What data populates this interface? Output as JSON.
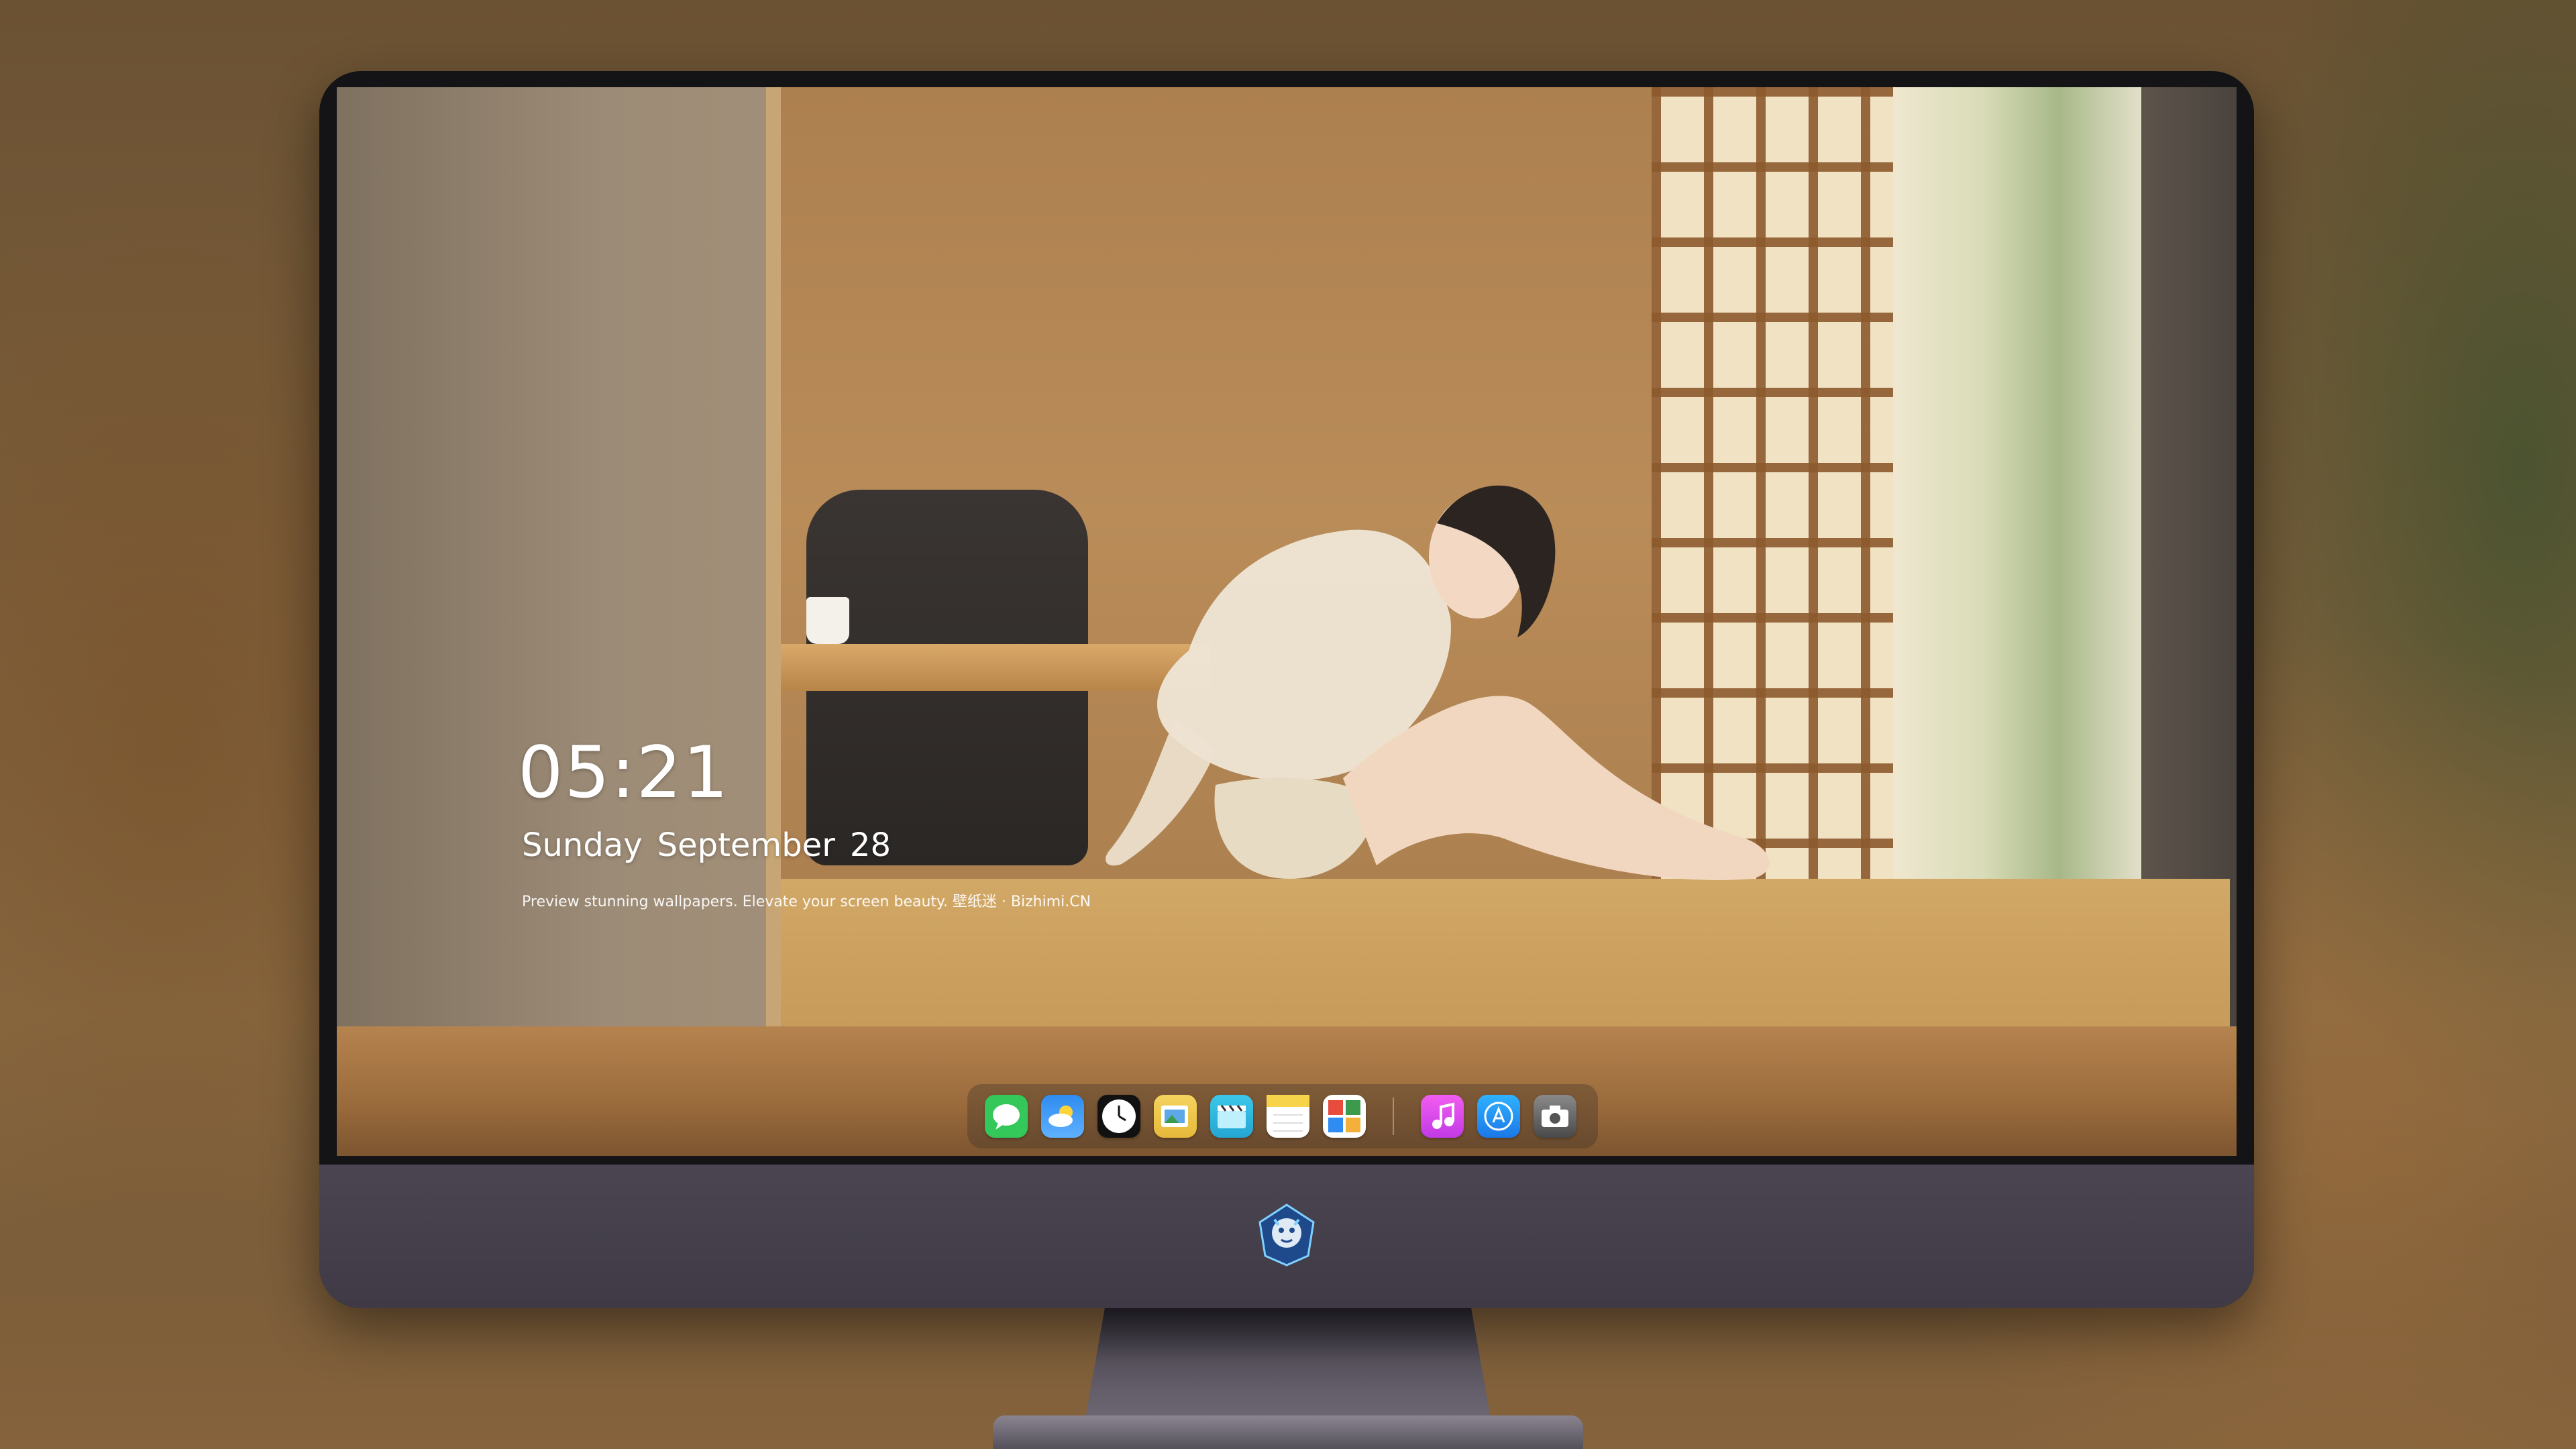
{
  "lock_screen": {
    "time": "05:21",
    "weekday": "Sunday",
    "month": "September",
    "day": "28",
    "tagline": "Preview stunning wallpapers. Elevate your screen beauty. 壁纸迷 · Bizhimi.CN"
  },
  "dock": {
    "apps": [
      {
        "name": "messages-icon",
        "color": "#34c759"
      },
      {
        "name": "weather-icon",
        "color": "#2f8cf0"
      },
      {
        "name": "clock-icon",
        "color": "#111111"
      },
      {
        "name": "preview-icon",
        "color": "#f4d35e"
      },
      {
        "name": "clips-icon",
        "color": "#3cc7e8"
      },
      {
        "name": "notes-icon",
        "color": "#f7d34b"
      },
      {
        "name": "photo-booth-icon",
        "color": "#e84c3d"
      },
      {
        "name": "music-icon",
        "color": "#d84cf0"
      },
      {
        "name": "app-store-icon",
        "color": "#1a8cf0"
      },
      {
        "name": "screenshot-icon",
        "color": "#5a5a5a"
      }
    ]
  },
  "monitor": {
    "chin_logo": "dragon-mascot-logo"
  }
}
